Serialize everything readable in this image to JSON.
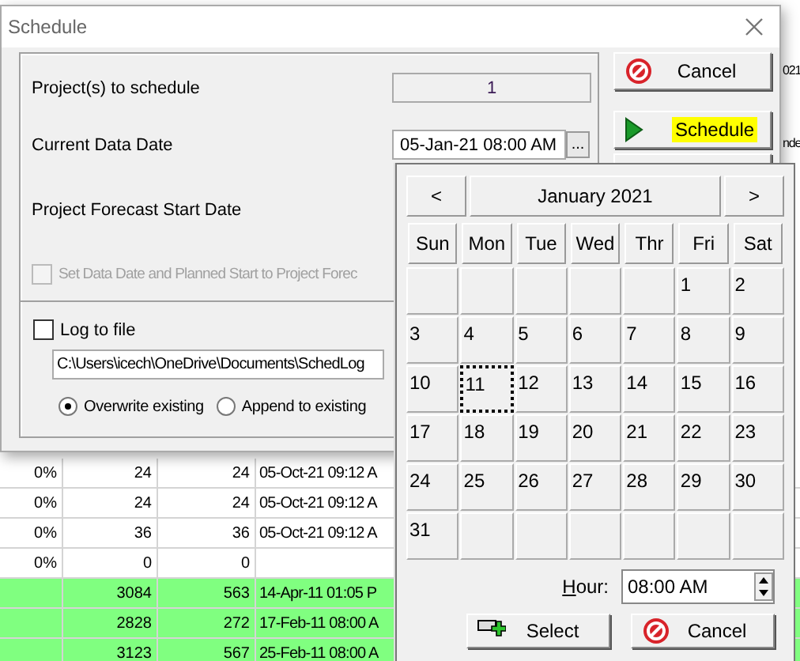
{
  "background_table": {
    "rows": [
      {
        "percent": "0%",
        "column_2": "24",
        "column_3": "24",
        "column_4": "05-Oct-21 09:12 A",
        "highlighted": false
      },
      {
        "percent": "0%",
        "column_2": "24",
        "column_3": "24",
        "column_4": "05-Oct-21 09:12 A",
        "highlighted": false
      },
      {
        "percent": "0%",
        "column_2": "36",
        "column_3": "36",
        "column_4": "05-Oct-21 09:12 A",
        "highlighted": false
      },
      {
        "percent": "0%",
        "column_2": "0",
        "column_3": "0",
        "highlighted": false
      },
      {
        "column_2": "3084",
        "column_3": "563",
        "column_4": "14-Apr-11 01:05 P",
        "highlighted": true
      },
      {
        "column_2": "2828",
        "column_3": "272",
        "column_4": "17-Feb-11 08:00 A",
        "highlighted": true
      },
      {
        "column_2": "3123",
        "column_3": "567",
        "column_4": "25-Feb-11 08:00 A",
        "highlighted": true
      }
    ],
    "fragments": [
      "021",
      "nde"
    ]
  },
  "dialog": {
    "title": "Schedule",
    "projects_label": "Project(s) to schedule",
    "projects_value": "1",
    "data_date_label": "Current Data Date",
    "data_date_value": "05-Jan-21 08:00 AM",
    "browse_button": "...",
    "forecast_label": "Project Forecast Start Date",
    "set_data_date": {
      "label": "Set Data Date and Planned Start to Project Forec",
      "checked": false,
      "disabled": true
    },
    "log_to_file": {
      "label": "Log to file",
      "checked": false,
      "disabled": false
    },
    "log_path": "C:\\Users\\icech\\OneDrive\\Documents\\SchedLog",
    "radios": [
      {
        "label": "Overwrite existing",
        "selected": true
      },
      {
        "label": "Append to existing",
        "selected": false
      }
    ],
    "buttons": [
      {
        "kind": "cancel",
        "label": "Cancel",
        "highlighted": false
      },
      {
        "kind": "play",
        "label": "Schedule",
        "highlighted": true
      }
    ]
  },
  "calendar": {
    "prev": "<",
    "title": "January 2021",
    "next": ">",
    "weekdays": [
      "Sun",
      "Mon",
      "Tue",
      "Wed",
      "Thr",
      "Fri",
      "Sat"
    ],
    "weeks": [
      [
        {
          "label": "1",
          "selected": false
        },
        {
          "label": "2",
          "selected": false
        }
      ],
      [
        {
          "label": "3",
          "selected": false
        },
        {
          "label": "4",
          "selected": false
        },
        {
          "label": "5",
          "selected": false
        },
        {
          "label": "6",
          "selected": false
        },
        {
          "label": "7",
          "selected": false
        },
        {
          "label": "8",
          "selected": false
        },
        {
          "label": "9",
          "selected": false
        }
      ],
      [
        {
          "label": "10",
          "selected": false
        },
        {
          "label": "11",
          "selected": true
        },
        {
          "label": "12",
          "selected": false
        },
        {
          "label": "13",
          "selected": false
        },
        {
          "label": "14",
          "selected": false
        },
        {
          "label": "15",
          "selected": false
        },
        {
          "label": "16",
          "selected": false
        }
      ],
      [
        {
          "label": "17",
          "selected": false
        },
        {
          "label": "18",
          "selected": false
        },
        {
          "label": "19",
          "selected": false
        },
        {
          "label": "20",
          "selected": false
        },
        {
          "label": "21",
          "selected": false
        },
        {
          "label": "22",
          "selected": false
        },
        {
          "label": "23",
          "selected": false
        }
      ],
      [
        {
          "label": "24",
          "selected": false
        },
        {
          "label": "25",
          "selected": false
        },
        {
          "label": "26",
          "selected": false
        },
        {
          "label": "27",
          "selected": false
        },
        {
          "label": "28",
          "selected": false
        },
        {
          "label": "29",
          "selected": false
        },
        {
          "label": "30",
          "selected": false
        }
      ],
      [
        {
          "label": "31",
          "selected": false
        }
      ]
    ],
    "hour_label": "Hour:",
    "hour_value": "08:00 AM",
    "buttons": [
      {
        "kind": "select",
        "label": "Select"
      },
      {
        "kind": "cancel",
        "label": "Cancel"
      }
    ]
  }
}
